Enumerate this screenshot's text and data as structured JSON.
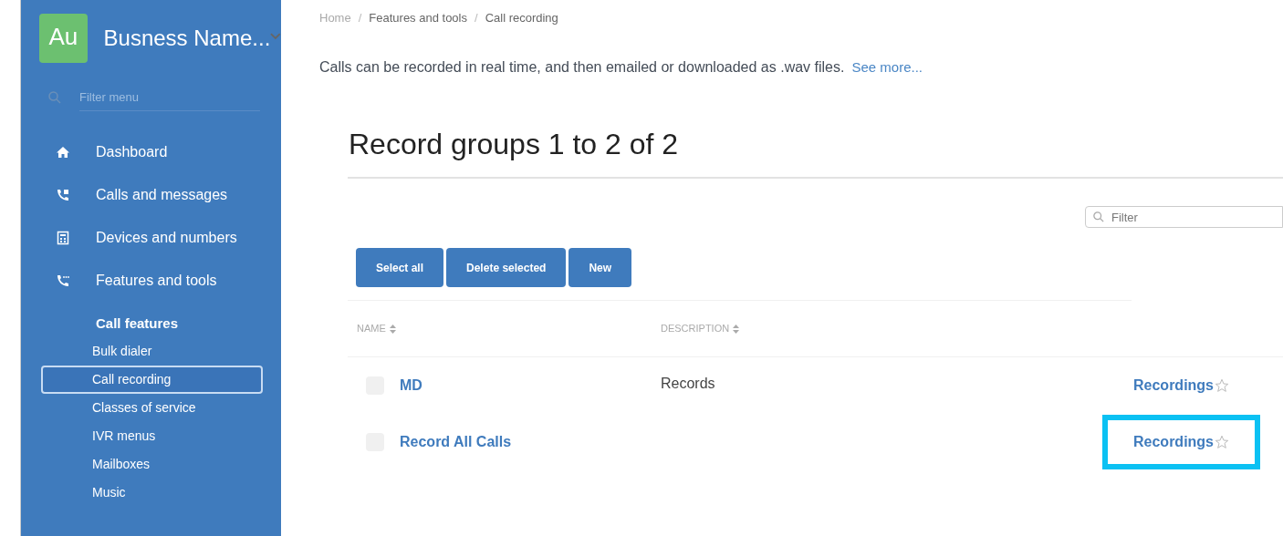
{
  "sidebar": {
    "logo": "Au",
    "business_name": "Busness Name...",
    "filter_placeholder": "Filter menu",
    "items": [
      {
        "label": "Dashboard",
        "kind": "home"
      },
      {
        "label": "Calls and messages",
        "kind": "calls"
      },
      {
        "label": "Devices and numbers",
        "kind": "devices"
      },
      {
        "label": "Features and tools",
        "kind": "features"
      }
    ],
    "section_title": "Call features",
    "subitems": [
      {
        "label": "Bulk dialer",
        "selected": false
      },
      {
        "label": "Call recording",
        "selected": true
      },
      {
        "label": "Classes of service",
        "selected": false
      },
      {
        "label": "IVR menus",
        "selected": false
      },
      {
        "label": "Mailboxes",
        "selected": false
      },
      {
        "label": "Music",
        "selected": false
      }
    ]
  },
  "breadcrumb": [
    "Home",
    "Features and tools",
    "Call recording"
  ],
  "breadcrumb_separator": "/",
  "description": "Calls can be recorded in real time, and then emailed or downloaded as .wav files.",
  "see_more": "See more...",
  "heading": "Record groups 1 to 2 of 2",
  "filter_placeholder": "Filter",
  "buttons": [
    "Select all",
    "Delete selected",
    "New"
  ],
  "table": {
    "columns": [
      "NAME",
      "DESCRIPTION"
    ],
    "rows": [
      {
        "name": "MD",
        "description": "Records",
        "link": "Recordings",
        "checked": false,
        "highlighted": false
      },
      {
        "name": "Record All Calls",
        "link": "Recordings",
        "checked": false,
        "highlighted": true
      }
    ]
  }
}
